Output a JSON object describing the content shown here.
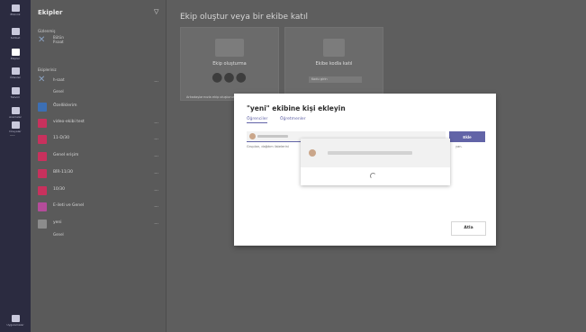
{
  "rail": {
    "items": [
      "Etkinlik",
      "Sohbet",
      "Ekipler",
      "Ödevler",
      "Takvim",
      "Aramalar",
      "Dosyalar"
    ],
    "more": "...",
    "bottom": "Uygulamalar"
  },
  "sidebar": {
    "title": "Ekipler",
    "sections": {
      "section_1": "Gizlenmiş",
      "section_2": "Ekipleriniz"
    },
    "hidden_team": {
      "name": "Bütün",
      "sub": "P.saat"
    },
    "pinned_team": {
      "name": "h-saat",
      "sub": "Genel"
    },
    "teams": [
      {
        "name": "Özelliklerim",
        "color": "#3c6fb4"
      },
      {
        "name": "video-ekibi test",
        "color": "#c8315d"
      },
      {
        "name": "11-D/30",
        "color": "#c8315d"
      },
      {
        "name": "Genel erişim",
        "color": "#c8315d"
      },
      {
        "name": "BİR-11/30",
        "color": "#c8315d"
      },
      {
        "name": "10/30",
        "color": "#c8315d"
      },
      {
        "name": "E-ileti ve Genel",
        "color": "#b44c9a"
      },
      {
        "name": "yeni",
        "color": "#8c8c8c"
      }
    ],
    "last_team_sub": "Genel",
    "more_label": "..."
  },
  "main": {
    "title": "Ekip oluştur veya bir ekibe katıl",
    "cards": [
      {
        "title": "Ekip oluşturma",
        "sub": "Arkadaşlarınızla ekip oluşturun"
      },
      {
        "title": "Ekibe kodla katıl",
        "field_placeholder": "Kodu girin"
      }
    ]
  },
  "modal": {
    "title": "\"yeni\" ekibine kişi ekleyin",
    "tabs": [
      "Öğrenciler",
      "Öğretmenler"
    ],
    "search_placeholder": "",
    "add_label": "Ekle",
    "hint": "Grupları, dağıtım listelerini",
    "hint_tail": "yan.",
    "close_label": "Atla",
    "colors": {
      "accent": "#6264a7"
    }
  }
}
